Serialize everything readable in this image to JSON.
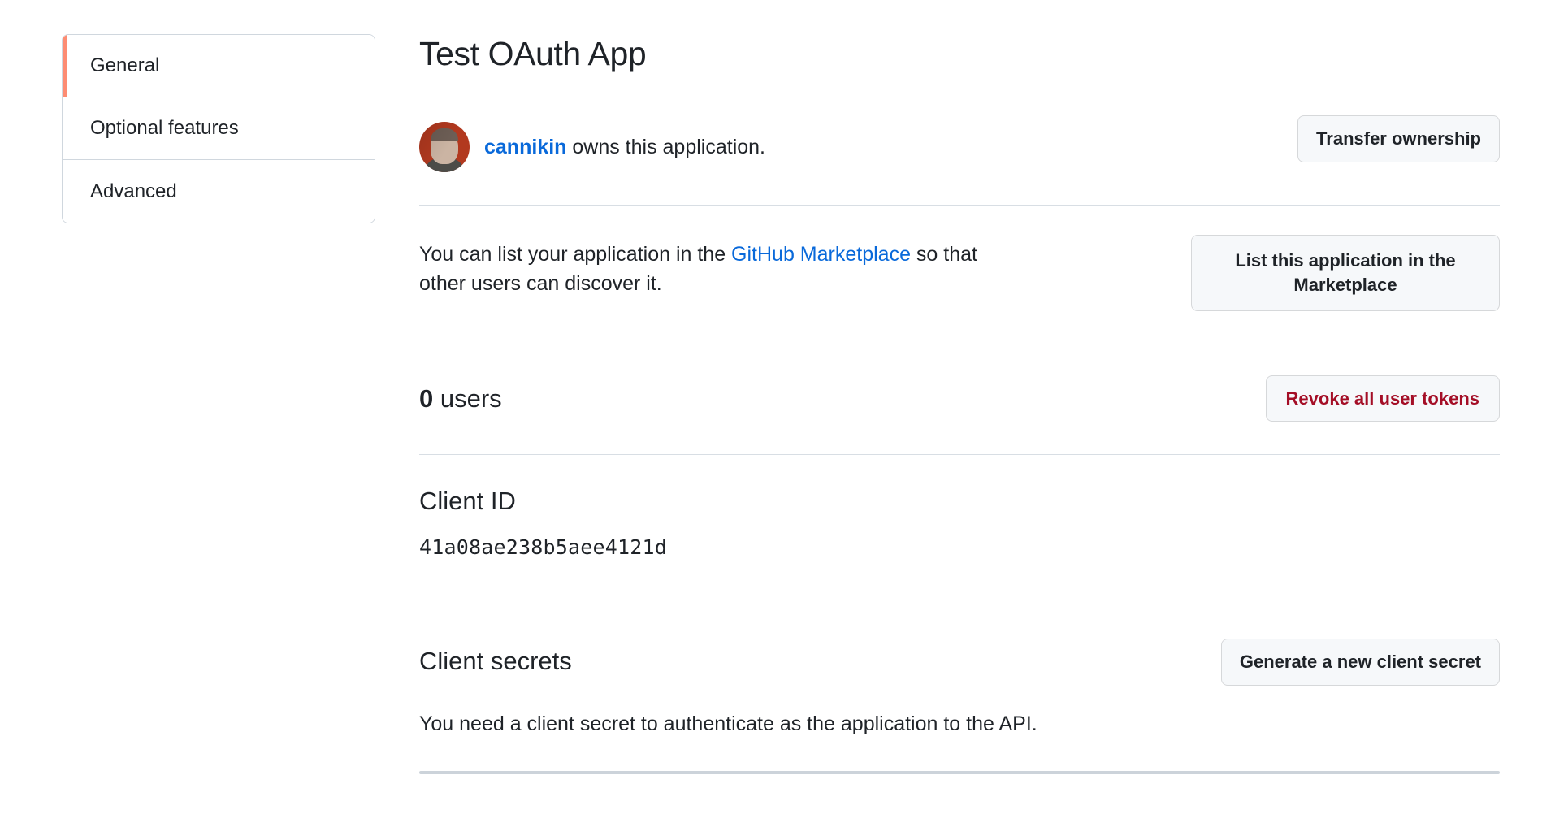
{
  "sidebar": {
    "items": [
      {
        "label": "General",
        "selected": true
      },
      {
        "label": "Optional features",
        "selected": false
      },
      {
        "label": "Advanced",
        "selected": false
      }
    ],
    "selected_accent_color": "#fd8c73"
  },
  "main": {
    "title": "Test OAuth App",
    "owner": {
      "avatar_alt": "cannikin",
      "username": "cannikin",
      "suffix_text": " owns this application.",
      "transfer_button": "Transfer ownership"
    },
    "marketplace": {
      "text_before_link": "You can list your application in the ",
      "link_text": "GitHub Marketplace",
      "text_after_link": " so that other users can discover it.",
      "button_label": "List this application in the Marketplace"
    },
    "users": {
      "count": "0",
      "label": " users",
      "revoke_button": "Revoke all user tokens",
      "revoke_button_color": "#a40e26"
    },
    "client_id": {
      "heading": "Client ID",
      "value": "41a08ae238b5aee4121d"
    },
    "client_secrets": {
      "heading": "Client secrets",
      "generate_button": "Generate a new client secret",
      "description": "You need a client secret to authenticate as the application to the API."
    }
  },
  "colors": {
    "link": "#0969da",
    "text": "#1f2328",
    "border": "#d0d7de",
    "divider": "#d8dee4",
    "button_bg": "#f6f8fa"
  }
}
